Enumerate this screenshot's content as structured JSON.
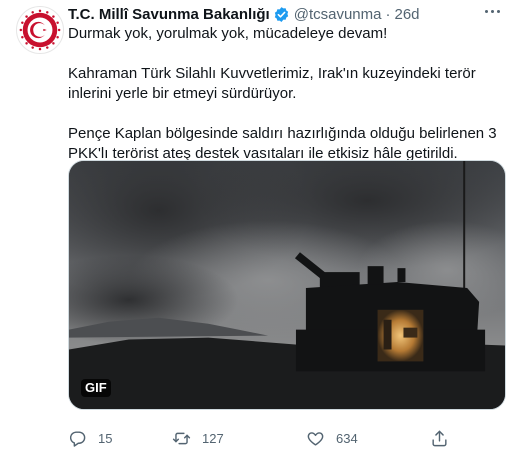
{
  "author": {
    "display_name": "T.C. Millî Savunma Bakanlığı",
    "handle": "@tcsavunma",
    "separator": "·",
    "time": "26d",
    "verified": true,
    "avatar_icon": "ministry-crest-icon",
    "avatar_color": "#c8102e"
  },
  "tweet": {
    "line1": "Durmak yok, yorulmak yok, mücadeleye devam!",
    "para2": "Kahraman Türk Silahlı Kuvvetlerimiz, Irak'ın kuzeyindeki terör inlerini yerle bir etmeyi sürdürüyor.",
    "para3": "Pençe Kaplan bölgesinde saldırı hazırlığında olduğu belirlenen 3 PKK'lı terörist ateş destek vasıtaları ile etkisiz hâle getirildi."
  },
  "media": {
    "type": "gif",
    "badge": "GIF",
    "description_icon": "artillery-silhouette-image"
  },
  "actions": {
    "reply": {
      "icon": "reply-icon",
      "count": "15"
    },
    "retweet": {
      "icon": "retweet-icon",
      "count": "127"
    },
    "like": {
      "icon": "heart-icon",
      "count": "634"
    },
    "share": {
      "icon": "share-icon"
    }
  },
  "colors": {
    "text_primary": "#0f1419",
    "text_secondary": "#536471",
    "verified_blue": "#1d9bf0",
    "border": "#cfd9de"
  }
}
